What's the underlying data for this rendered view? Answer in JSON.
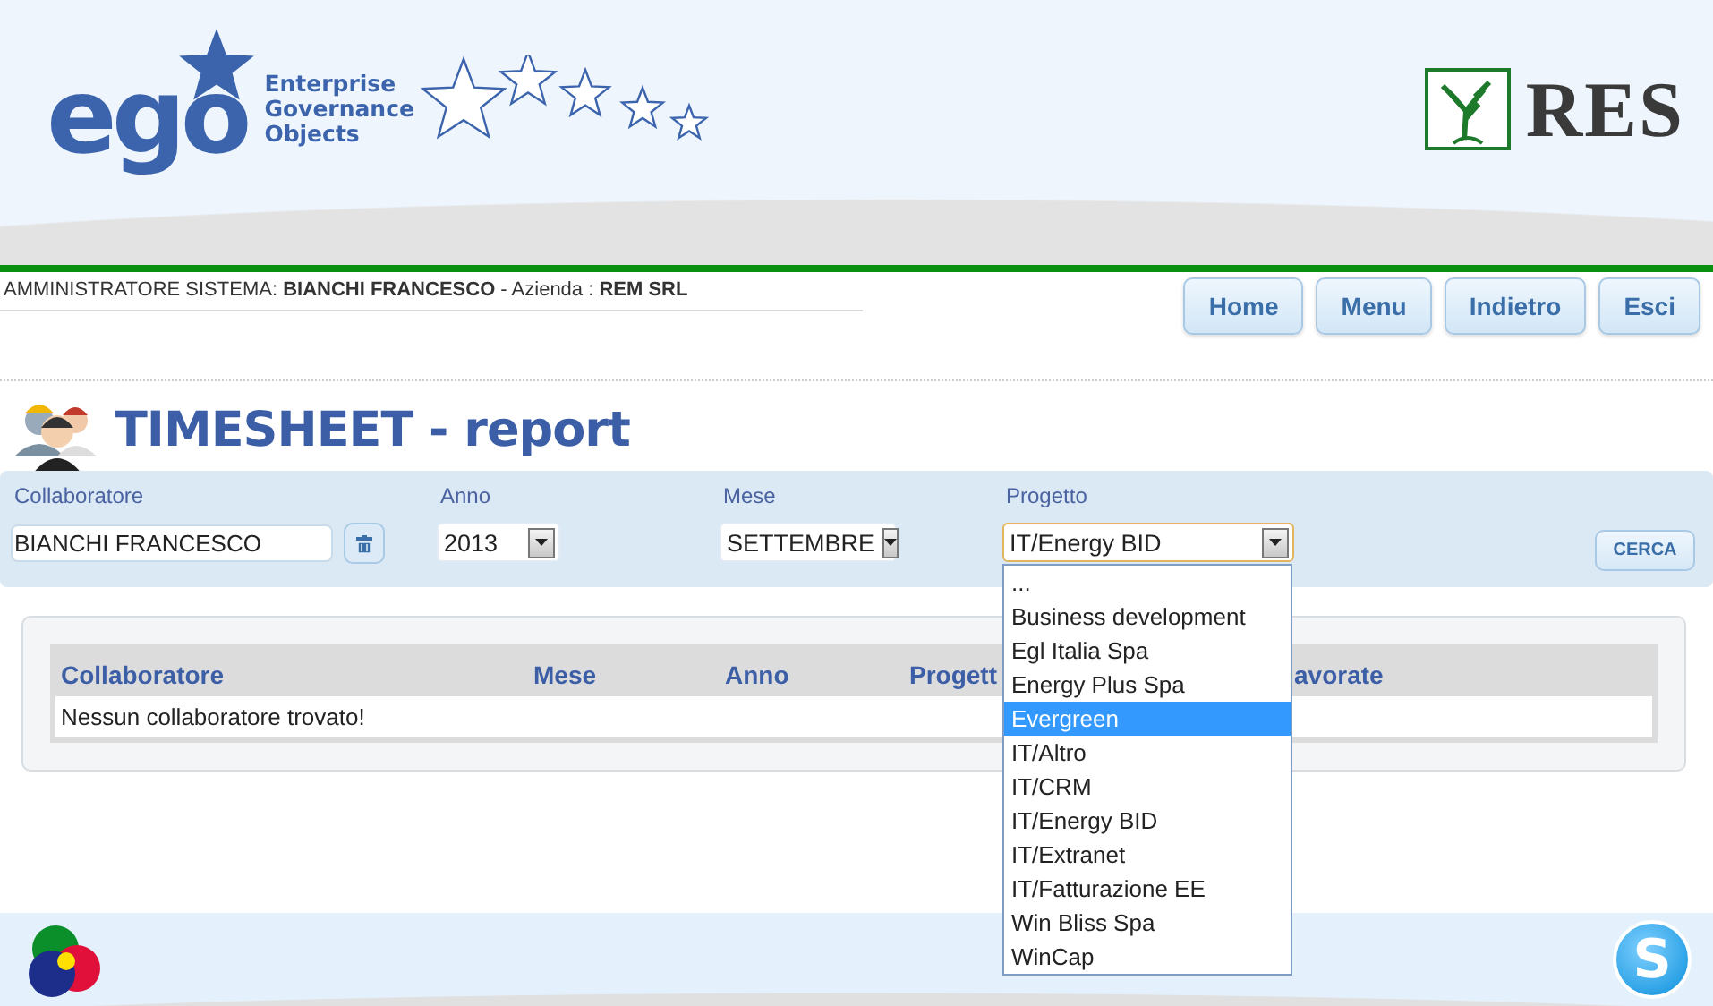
{
  "header": {
    "logo_text": "ego",
    "logo_tagline": [
      "Enterprise",
      "Governance",
      "Objects"
    ],
    "partner_logo_text": "RES"
  },
  "user_bar": {
    "text": "AMMINISTRATORE SISTEMA: **BIANCHI FRANCESCO** - Azienda : **REM SRL**"
  },
  "nav_buttons": [
    "Home",
    "Menu",
    "Indietro",
    "Esci"
  ],
  "page_title": "TIMESHEET - report",
  "filters": {
    "collaboratore": {
      "label": "Collaboratore",
      "value": "BIANCHI FRANCESCO"
    },
    "anno": {
      "label": "Anno",
      "value": "2013"
    },
    "mese": {
      "label": "Mese",
      "value": "SETTEMBRE"
    },
    "progetto": {
      "label": "Progetto",
      "value": "IT/Energy BID",
      "expanded": true,
      "options": [
        {
          "label": "...",
          "highlighted": false
        },
        {
          "label": "Business development",
          "highlighted": false
        },
        {
          "label": "Egl Italia Spa",
          "highlighted": false
        },
        {
          "label": "Energy Plus Spa",
          "highlighted": false
        },
        {
          "label": "Evergreen",
          "highlighted": true
        },
        {
          "label": "IT/Altro",
          "highlighted": false
        },
        {
          "label": "IT/CRM",
          "highlighted": false
        },
        {
          "label": "IT/Energy BID",
          "highlighted": false
        },
        {
          "label": "IT/Extranet",
          "highlighted": false
        },
        {
          "label": "IT/Fatturazione EE",
          "highlighted": false
        },
        {
          "label": "Win Bliss Spa",
          "highlighted": false
        },
        {
          "label": "WinCap",
          "highlighted": false
        }
      ]
    },
    "search_button": "CERCA"
  },
  "table": {
    "columns": [
      "Collaboratore",
      "Mese",
      "Anno",
      "Progett",
      "avorate"
    ],
    "empty_message": "Nessun collaboratore trovato!"
  },
  "footer": {
    "chat_glyph": "S"
  }
}
